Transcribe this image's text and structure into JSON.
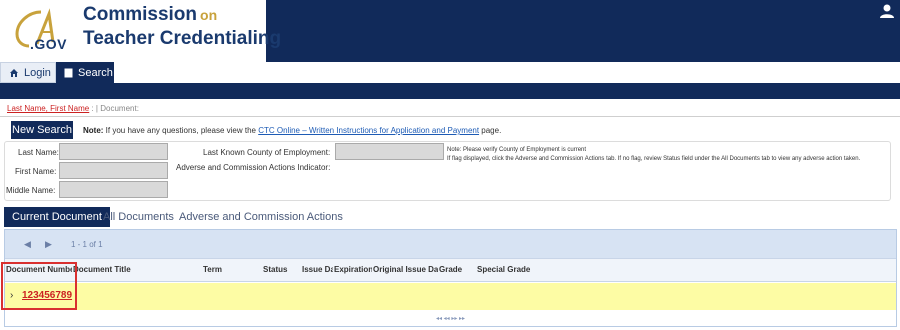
{
  "header": {
    "logo_gov": ".GOV",
    "org_line1": "Commission",
    "org_line1_suffix": "on",
    "org_line2": "Teacher Credentialing",
    "colors": {
      "navy": "#112a5a",
      "gold": "#c8a23c"
    },
    "user_icon": "user-icon"
  },
  "nav": {
    "login_label": "Login",
    "login_icon": "home-icon",
    "search_label": "Search",
    "search_icon": "document-icon"
  },
  "breadcrumb": {
    "name": "Last Name, First Name",
    "separator": ": | ",
    "document": "Document:"
  },
  "toolbar": {
    "new_search_label": "New Search",
    "note_prefix": "Note:",
    "note_text": " If you have any questions, please view the ",
    "note_link": "CTC Online – Written Instructions for Application and Payment",
    "note_suffix": " page."
  },
  "form": {
    "last_name_label": "Last Name:",
    "first_name_label": "First Name:",
    "middle_name_label": "Middle Name:",
    "county_label": "Last Known County of Employment:",
    "adverse_label": "Adverse and Commission Actions Indicator:",
    "note_line1": "Note: Please verify County of Employment is current",
    "note_line2": "If flag displayed, click the Adverse and Commission Actions tab. If no flag, review Status field under the All Documents tab to view any adverse action taken."
  },
  "tabs": [
    {
      "label": "Current Document",
      "active": true
    },
    {
      "label": "All Documents",
      "active": false
    },
    {
      "label": "Adverse and Commission Actions",
      "active": false
    }
  ],
  "grid": {
    "pager_count": "1 - 1 of 1",
    "columns": [
      "Document Number",
      "Document Title",
      "Term",
      "Status",
      "Issue Date",
      "Expiration",
      "Original Issue Date",
      "Grade",
      "Special Grade"
    ],
    "rows": [
      {
        "document_number": "123456789"
      }
    ],
    "bottom_pager": "◂◂  ◂◂  ▸▸  ▸▸"
  }
}
